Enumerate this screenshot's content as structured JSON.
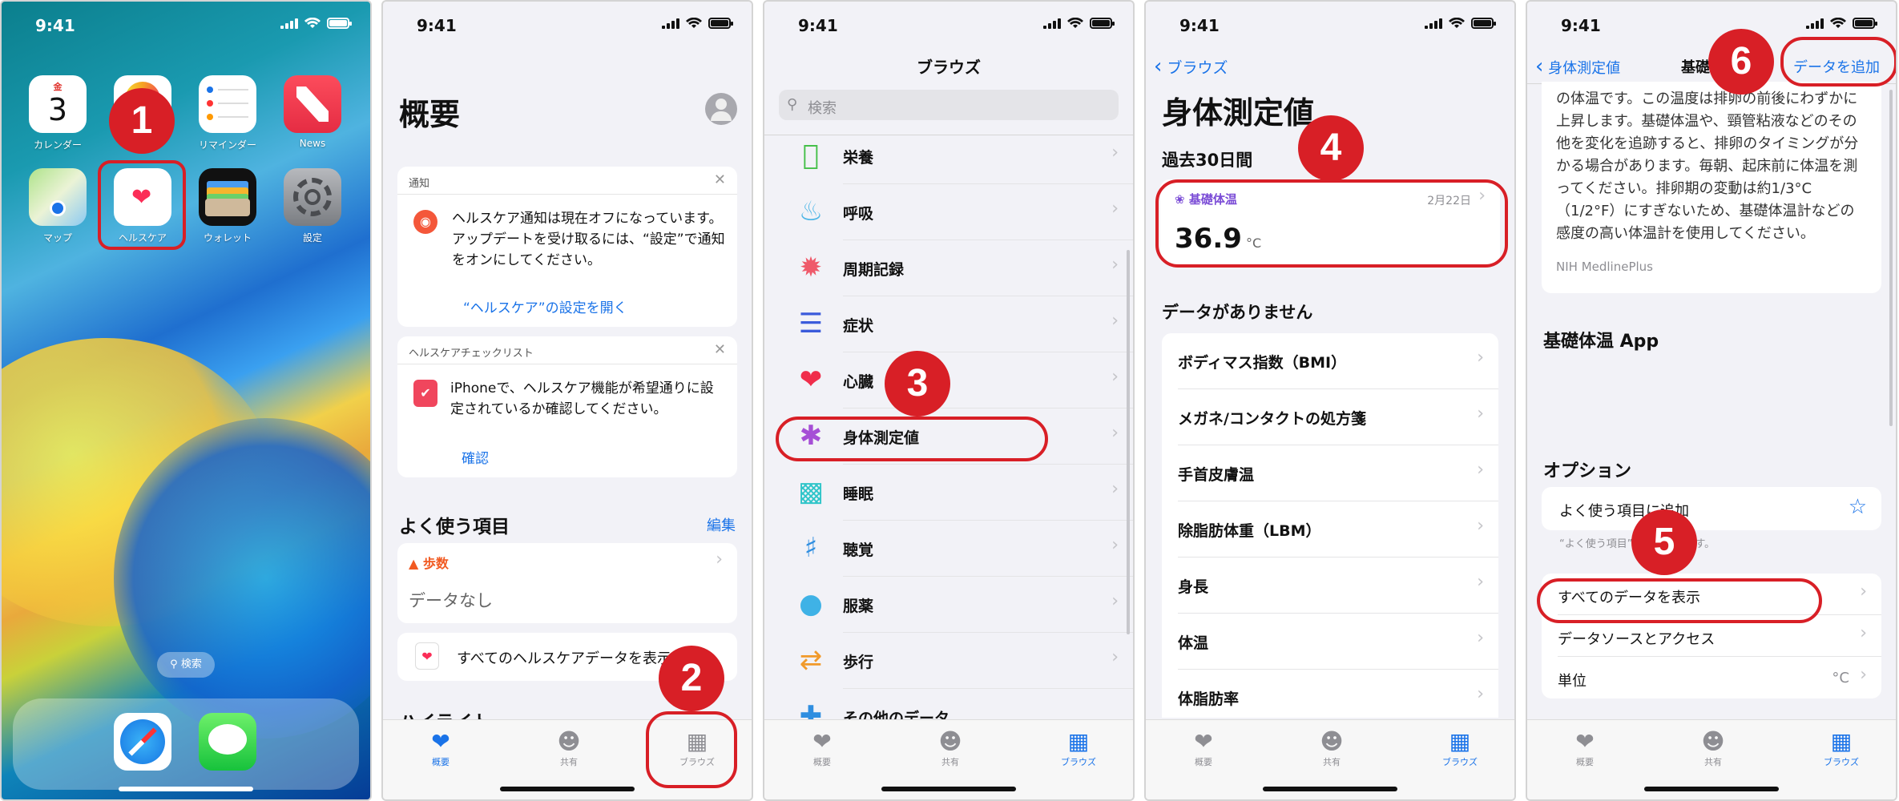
{
  "status": {
    "time": "9:41"
  },
  "screen1": {
    "date_weekday": "金",
    "date_day": "3",
    "apps": [
      {
        "label": "カレンダー"
      },
      {
        "label": ""
      },
      {
        "label": "リマインダー"
      },
      {
        "label": "News"
      },
      {
        "label": "マップ"
      },
      {
        "label": "ヘルスケア"
      },
      {
        "label": "ウォレット"
      },
      {
        "label": "設定"
      }
    ],
    "search_label": "検索"
  },
  "screen2": {
    "title": "概要",
    "notice_header": "通知",
    "notice_text": "ヘルスケア通知は現在オフになっています。アップデートを受け取るには、“設定”で通知をオンにしてください。",
    "notice_link": "“ヘルスケア”の設定を開く",
    "checklist_header": "ヘルスケアチェックリスト",
    "checklist_text": "iPhoneで、ヘルスケア機能が希望通りに設定されているか確認してください。",
    "checklist_link": "確認",
    "favorites_title": "よく使う項目",
    "favorites_edit": "編集",
    "steps_label": "歩数",
    "steps_value": "データなし",
    "all_data_label": "すべてのヘルスケアデータを表示",
    "highlights": "ハイライト"
  },
  "screen3": {
    "title": "ブラウズ",
    "search_placeholder": "検索",
    "items": [
      {
        "label": "栄養"
      },
      {
        "label": "呼吸"
      },
      {
        "label": "周期記録"
      },
      {
        "label": "症状"
      },
      {
        "label": "心臓"
      },
      {
        "label": "身体測定値"
      },
      {
        "label": "睡眠"
      },
      {
        "label": "聴覚"
      },
      {
        "label": "服薬"
      },
      {
        "label": "歩行"
      },
      {
        "label": "その他のデータ"
      }
    ]
  },
  "screen4": {
    "back": "ブラウズ",
    "title": "身体測定値",
    "section_recent": "過去30日間",
    "metric_label": "基礎体温",
    "metric_date": "2月22日",
    "metric_value": "36.9",
    "metric_unit": "°C",
    "section_nodata": "データがありません",
    "items": [
      {
        "label": "ボディマス指数（BMI）"
      },
      {
        "label": "メガネ/コンタクトの処方箋"
      },
      {
        "label": "手首皮膚温"
      },
      {
        "label": "除脂肪体重（LBM）"
      },
      {
        "label": "身長"
      },
      {
        "label": "体温"
      },
      {
        "label": "体脂肪率"
      }
    ]
  },
  "screen5": {
    "back": "身体測定値",
    "title": "基礎",
    "add_data": "データを追加",
    "body_text": "の体温です。この温度は排卵の前後にわずかに上昇します。基礎体温や、頸管粘液などのその他を変化を追跡すると、排卵のタイミングが分かる場合があります。毎朝、起床前に体温を測ってください。排卵期の変動は約1/3°C（1/2°F）にすぎないため、基礎体温計などの感度の高い体温計を使用してください。",
    "source": "NIH MedlinePlus",
    "apps_title": "基礎体温 App",
    "options_title": "オプション",
    "add_favorite": "よく使う項目に追加",
    "favorite_note": "“よく使う項目”に表示されます。",
    "show_all": "すべてのデータを表示",
    "sources": "データソースとアクセス",
    "units": "単位",
    "units_value": "°C"
  },
  "tabs": {
    "summary": "概要",
    "sharing": "共有",
    "browse": "ブラウズ"
  },
  "steps": [
    "1",
    "2",
    "3",
    "4",
    "5",
    "6"
  ],
  "colors": {
    "accent": "#1a73e8",
    "highlight": "#d81f26"
  }
}
